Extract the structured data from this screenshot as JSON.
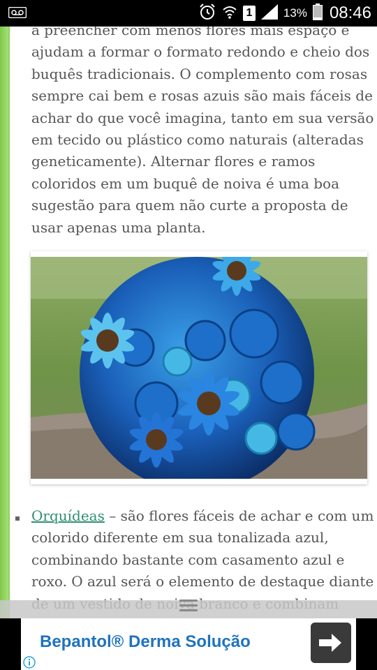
{
  "status_bar": {
    "sim_badge": "1",
    "battery": "13%",
    "time": "08:46",
    "icons": [
      "voicemail-icon",
      "alarm-icon",
      "wifi-icon",
      "signal-icon",
      "battery-icon"
    ]
  },
  "article": {
    "paragraph_lines": [
      "a preencher com menos flores mais espaço e",
      "ajudam a formar o formato redondo e cheio dos",
      "buquês tradicionais. O complemento com rosas",
      "sempre cai bem e rosas azuis são mais fáceis de",
      "achar do que você imagina, tanto em sua versão",
      "em tecido ou plástico como naturais (alteradas",
      "geneticamente). Alternar flores e ramos",
      "coloridos em um buquê de noiva é uma boa",
      "sugestão para quem não curte a proposta de",
      "usar apenas uma planta."
    ],
    "bullet": {
      "link_text": "Orquídeas",
      "first_line_rest": " – são flores fáceis de achar e com um",
      "lines": [
        "colorido diferente em sua tonalizada azul,",
        "combinando bastante com casamento azul e",
        "roxo. O azul será o elemento de destaque diante",
        "de um vestido de noiva branco e combinam"
      ]
    }
  },
  "ad": {
    "title": "Bepantol® Derma Solução",
    "arrow_icon": "arrow-right-icon",
    "info_icon": "info-icon"
  },
  "colors": {
    "side_green": "#8fd35a",
    "link": "#2f8f6f",
    "ad_title": "#1e73be"
  }
}
